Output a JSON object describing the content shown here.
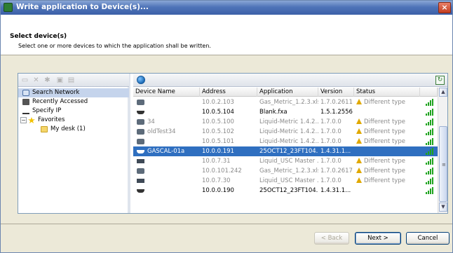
{
  "window": {
    "title": "Write application to Device(s)...",
    "close_glyph": "×"
  },
  "header": {
    "title": "Select device(s)",
    "subtitle": "Select one or more devices to which the application shall be written."
  },
  "left_toolbar": {
    "icons": [
      "new-folder-icon",
      "delete-icon",
      "settings-icon",
      "save-icon",
      "copy-icon"
    ]
  },
  "tree": [
    {
      "label": "Search Network",
      "icon": "search-network-icon",
      "selected": true
    },
    {
      "label": "Recently Accessed",
      "icon": "recent-icon"
    },
    {
      "label": "Specify IP",
      "icon": "ip-icon"
    },
    {
      "label": "Favorites",
      "icon": "star-icon",
      "expander": "−"
    },
    {
      "label": "My desk (1)",
      "icon": "folder-icon",
      "indent": true
    }
  ],
  "table": {
    "columns": [
      "Device Name",
      "Address",
      "Application",
      "Version",
      "Status"
    ],
    "rows": [
      {
        "name": "",
        "address": "10.0.2.103",
        "application": "Gas_Metric_1.2.3.xls",
        "version": "1.7.0.2611",
        "status": "Different type",
        "warn": true,
        "grey": true,
        "icon": "gascal-meter-icon",
        "signal": 4
      },
      {
        "name": "",
        "address": "10.0.5.104",
        "application": "Blank.fxa",
        "version": "1.5.1.2556",
        "status": "",
        "warn": false,
        "grey": false,
        "icon": "device-icon",
        "signal": 4
      },
      {
        "name": "34",
        "address": "10.0.5.100",
        "application": "Liquid-Metric 1.4.2....",
        "version": "1.7.0.0",
        "status": "Different type",
        "warn": true,
        "grey": true,
        "icon": "gascal-meter-icon",
        "signal": 4
      },
      {
        "name": "oldTest34",
        "address": "10.0.5.102",
        "application": "Liquid-Metric 1.4.2....",
        "version": "1.7.0.0",
        "status": "Different type",
        "warn": true,
        "grey": true,
        "icon": "gascal-meter-icon",
        "signal": 4
      },
      {
        "name": "",
        "address": "10.0.5.101",
        "application": "Liquid-Metric 1.4.2....",
        "version": "1.7.0.0",
        "status": "Different type",
        "warn": true,
        "grey": true,
        "icon": "gascal-meter-icon",
        "signal": 4
      },
      {
        "name": "GASCAL-01a",
        "address": "10.0.0.191",
        "application": "25OCT12_23FT104...",
        "version": "1.4.31.1...",
        "status": "",
        "warn": false,
        "grey": false,
        "selected": true,
        "icon": "device-icon",
        "signal": 4
      },
      {
        "name": "",
        "address": "10.0.7.31",
        "application": "Liquid_USC Master ...",
        "version": "1.7.0.0",
        "status": "Different type",
        "warn": true,
        "grey": true,
        "icon": "network-device-icon",
        "signal": 4
      },
      {
        "name": "",
        "address": "10.0.101.242",
        "application": "Gas_Metric_1.2.3.xls",
        "version": "1.7.0.2617",
        "status": "Different type",
        "warn": true,
        "grey": true,
        "icon": "gascal-meter-icon",
        "signal": 4
      },
      {
        "name": "",
        "address": "10.0.7.30",
        "application": "Liquid_USC Master ...",
        "version": "1.7.0.0",
        "status": "Different type",
        "warn": true,
        "grey": true,
        "icon": "network-device-icon",
        "signal": 4
      },
      {
        "name": "",
        "address": "10.0.0.190",
        "application": "25OCT12_23FT104...",
        "version": "1.4.31.1...",
        "status": "",
        "warn": false,
        "grey": false,
        "icon": "device-icon",
        "signal": 4
      }
    ]
  },
  "buttons": {
    "back": "< Back",
    "next": "Next >",
    "cancel": "Cancel"
  },
  "colors": {
    "selection": "#2f6fc0",
    "signal": "#1fa31f",
    "warning": "#e0a800",
    "title_bar": "#3c60a8"
  }
}
